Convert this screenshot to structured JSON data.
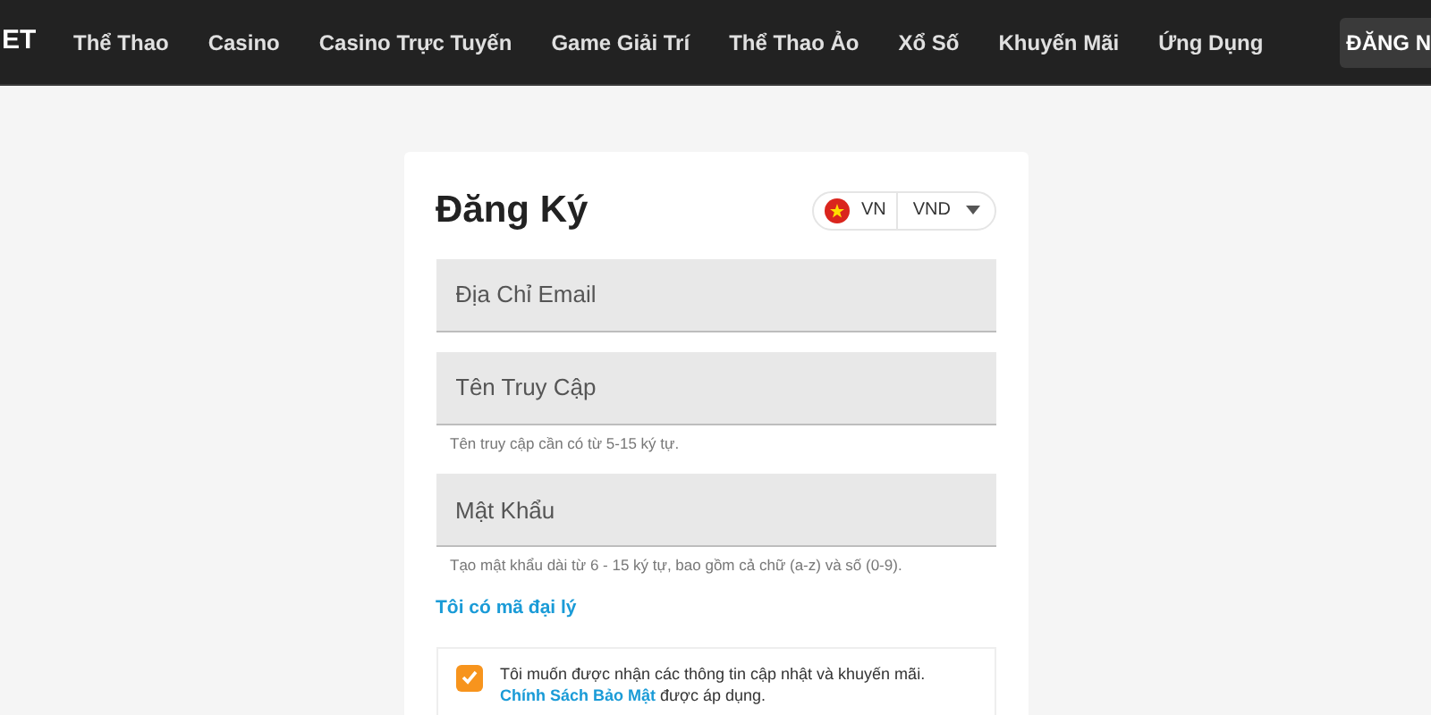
{
  "header": {
    "logo": "ET",
    "nav": [
      {
        "label": "Thể Thao"
      },
      {
        "label": "Casino"
      },
      {
        "label": "Casino Trực Tuyến"
      },
      {
        "label": "Game Giải Trí"
      },
      {
        "label": "Thể Thao Ảo"
      },
      {
        "label": "Xổ Số"
      },
      {
        "label": "Khuyến Mãi"
      },
      {
        "label": "Ứng Dụng"
      }
    ],
    "register_button": "ĐĂNG N"
  },
  "form": {
    "title": "Đăng Ký",
    "country": "VN",
    "currency": "VND",
    "fields": [
      {
        "placeholder": "Địa Chỉ Email"
      },
      {
        "placeholder": "Tên Truy Cập",
        "hint": "Tên truy cập cần có từ 5-15 ký tự."
      },
      {
        "placeholder": "Mật Khẩu",
        "hint": "Tạo mật khẩu dài từ 6 - 15 ký tự, bao gồm cả chữ (a-z) và số (0-9)."
      }
    ],
    "agent_link": "Tôi có mã đại lý",
    "consent": {
      "checked": true,
      "text": "Tôi muốn được nhận các thông tin cập nhật và khuyến mãi.",
      "link": "Chính Sách Bảo Mật",
      "suffix": "được áp dụng."
    }
  }
}
